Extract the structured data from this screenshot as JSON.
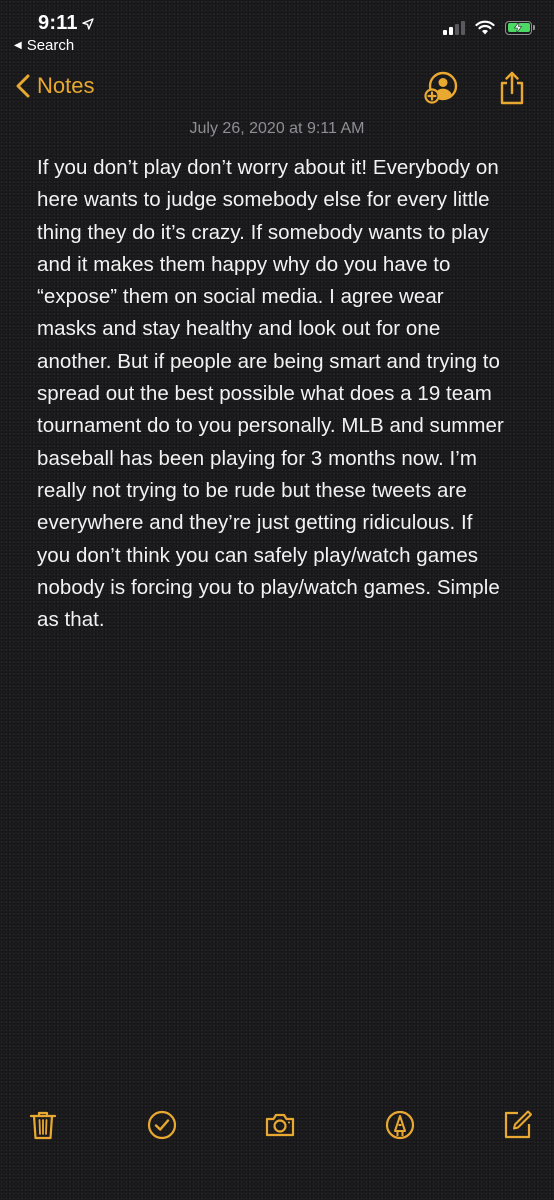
{
  "status_bar": {
    "time": "9:11",
    "back_app": "Search",
    "icons": [
      "location-arrow-icon",
      "cellular-signal-icon",
      "wifi-icon",
      "battery-charging-icon"
    ]
  },
  "nav": {
    "back_label": "Notes",
    "icons": [
      "add-people-icon",
      "share-icon"
    ]
  },
  "note": {
    "date": "July 26, 2020 at 9:11 AM",
    "body": "If you don’t play don’t worry about it! Everybody on here wants to judge somebody else for every little thing they do it’s crazy. If somebody wants to play and it makes them happy why do you have to “expose” them on social media. I agree wear masks and stay healthy and look out for one another. But if people are being smart and trying to spread out the best possible what does a 19 team tournament do to you personally. MLB and summer baseball has been playing for 3 months now. I’m really not trying to be rude but these tweets are everywhere and they’re just getting ridiculous. If you don’t think you can safely play/watch games nobody is forcing you to play/watch games. Simple as that."
  },
  "toolbar": {
    "icons": [
      "trash-icon",
      "checklist-icon",
      "camera-icon",
      "markup-icon",
      "compose-icon"
    ]
  },
  "colors": {
    "accent": "#e9a931",
    "background": "#1c1c1e",
    "text": "#f2f2f2",
    "secondary_text": "#8e8e93",
    "battery_fill": "#4cd964"
  }
}
